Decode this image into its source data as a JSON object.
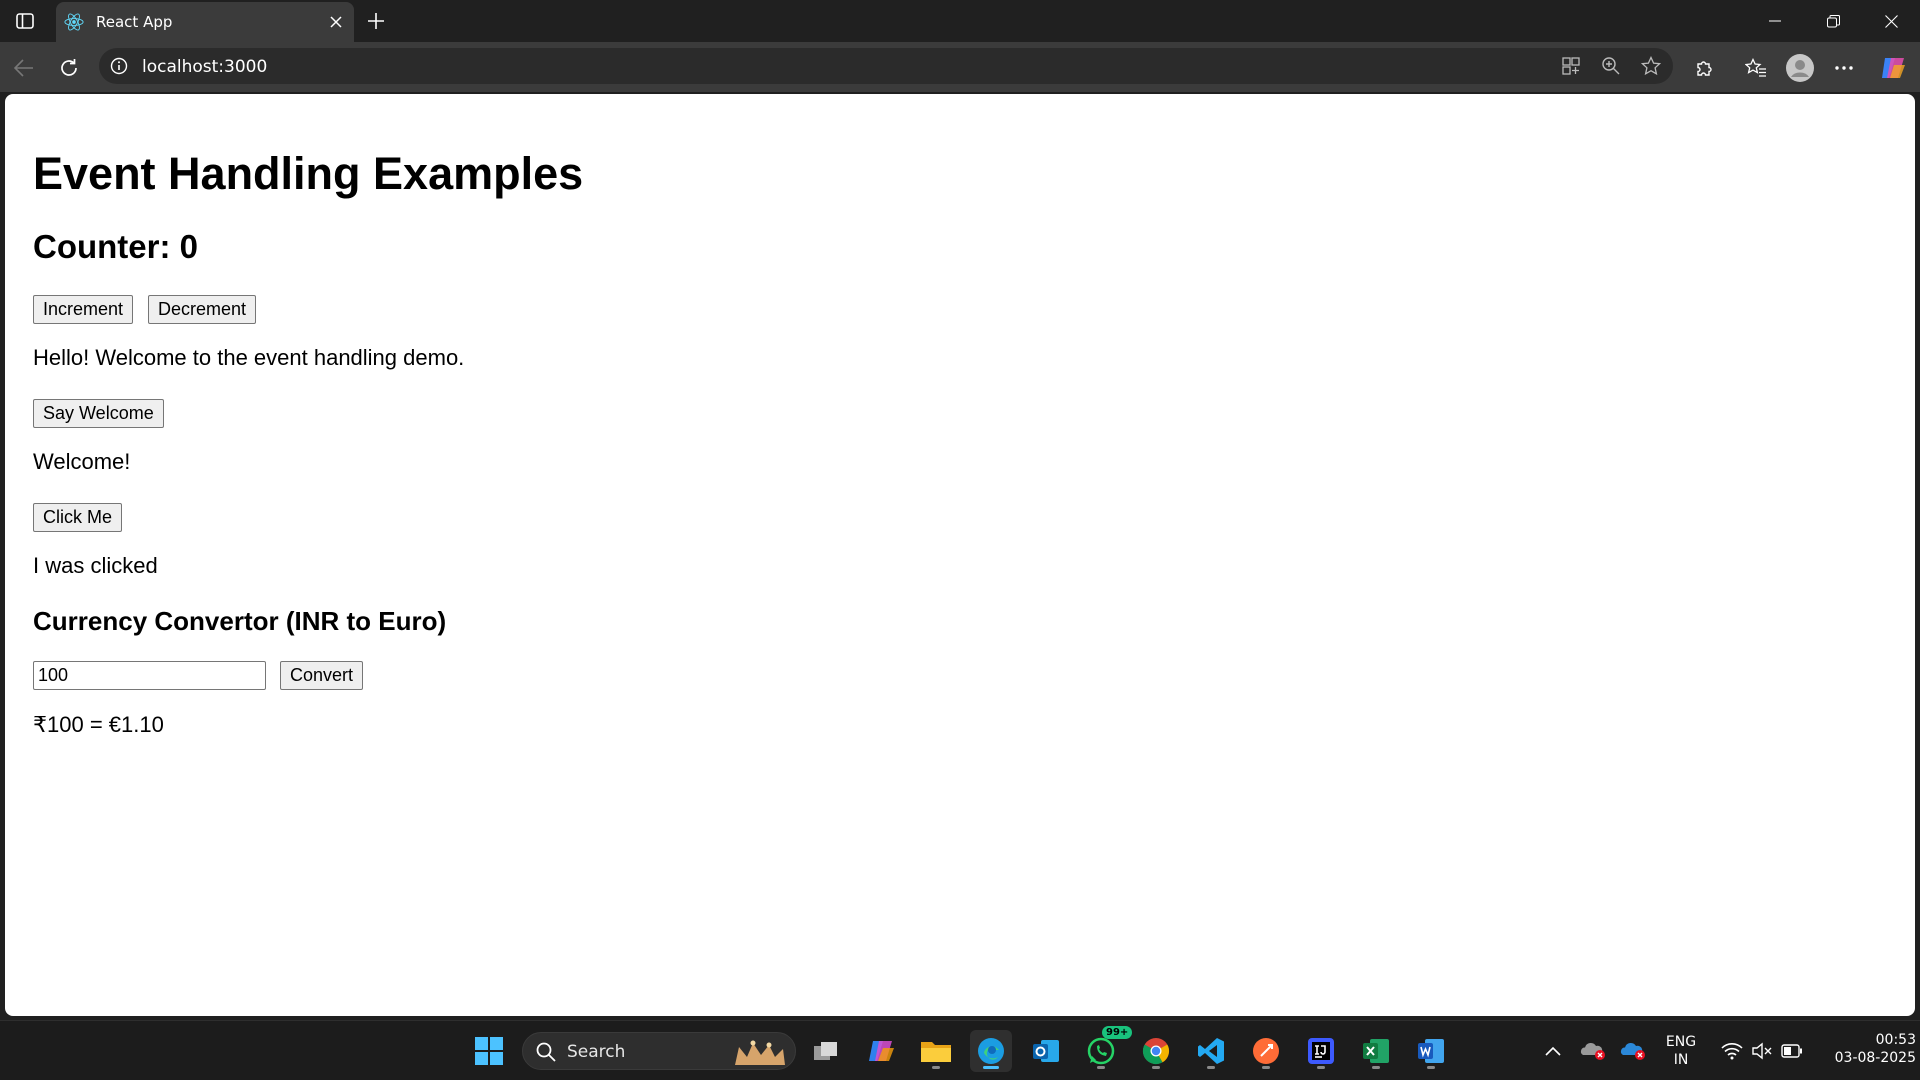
{
  "browser": {
    "tab": {
      "title": "React App",
      "favicon": "react-logo-icon"
    },
    "address": {
      "url": "localhost:3000"
    }
  },
  "page": {
    "title": "Event Handling Examples",
    "counter_label": "Counter: 0",
    "increment_label": "Increment",
    "decrement_label": "Decrement",
    "hello_text": "Hello! Welcome to the event handling demo.",
    "say_welcome_label": "Say Welcome",
    "welcome_text": "Welcome!",
    "click_me_label": "Click Me",
    "clicked_text": "I was clicked",
    "currency_heading": "Currency Convertor (INR to Euro)",
    "currency_input_value": "100",
    "convert_label": "Convert",
    "result_text": "₹100 = €1.10"
  },
  "taskbar": {
    "search_label": "Search",
    "whatsapp_badge": "99+",
    "lang_line1": "ENG",
    "lang_line2": "IN",
    "time": "00:53",
    "date": "03-08-2025"
  },
  "colors": {
    "accent": "#4cc2ff",
    "chrome_dark": "#202020",
    "tab_active": "#3b3b3b",
    "page_bg": "#ffffff"
  }
}
